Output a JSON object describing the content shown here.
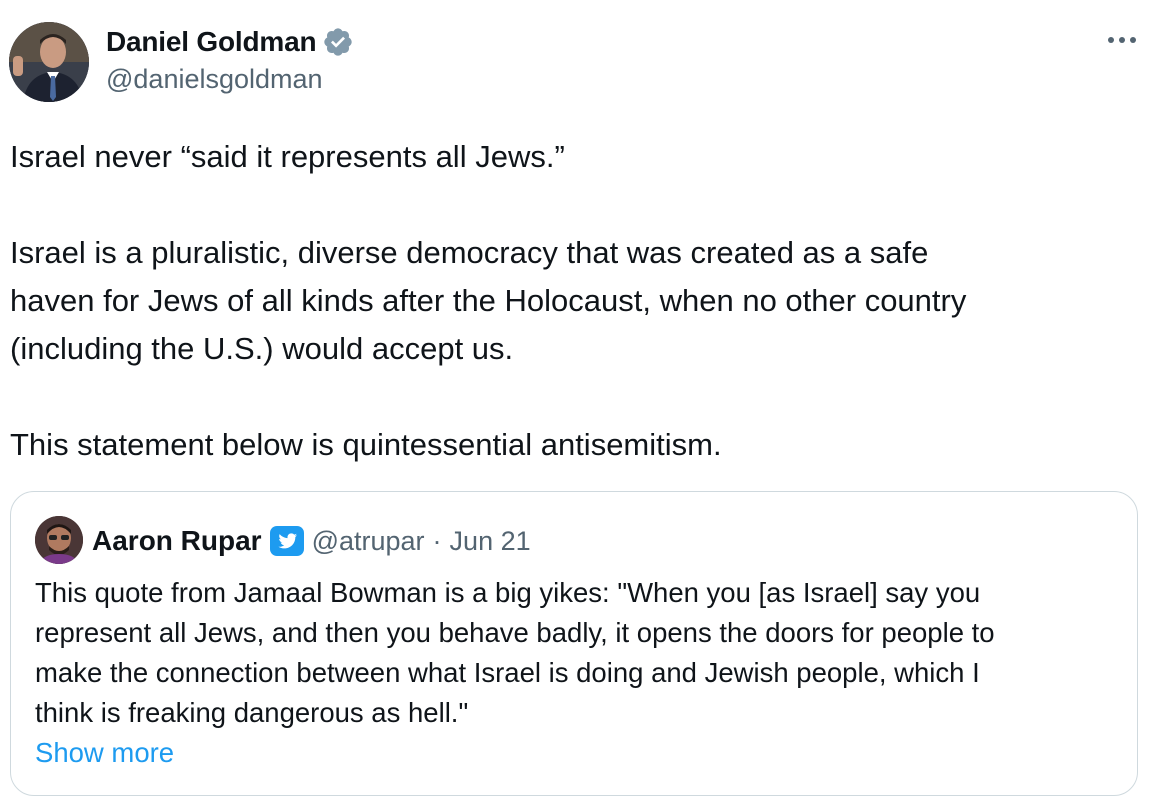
{
  "author": {
    "display_name": "Daniel Goldman",
    "handle": "@danielsgoldman",
    "verified_icon": "verified-badge-gray"
  },
  "actions": {
    "more_icon": "more-horizontal-icon"
  },
  "tweet": {
    "lines": [
      "Israel never “said it represents all Jews.”",
      "Israel is a pluralistic, diverse democracy that was created as a safe",
      "haven for Jews of all kinds after the Holocaust, when no other country",
      "(including the U.S.) would accept us.",
      "This statement below is quintessential antisemitism."
    ]
  },
  "quote": {
    "display_name": "Aaron Rupar",
    "badge_icon": "twitter-bird-badge-icon",
    "handle": "@atrupar",
    "separator": "·",
    "date": "Jun 21",
    "lines": [
      "This quote from Jamaal Bowman is a big yikes: \"When you [as Israel] say you",
      "represent all Jews, and then you behave badly, it opens the doors for people to",
      "make the connection between what Israel is doing and Jewish people, which I",
      "think is freaking dangerous as hell.\""
    ],
    "show_more": "Show more"
  },
  "colors": {
    "text": "#0f1419",
    "secondary": "#536471",
    "link": "#1d9bf0",
    "border": "#cfd9de",
    "verified_gray": "#829aab"
  }
}
